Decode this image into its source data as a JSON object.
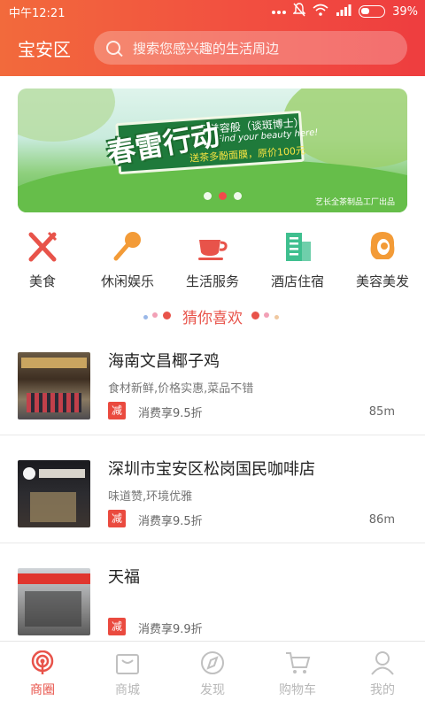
{
  "status_bar": {
    "time": "中午12:21",
    "more_icon": "more-dots-icon",
    "mute_icon": "bell-off-icon",
    "wifi_icon": "wifi-icon",
    "signal_icon": "signal-icon",
    "battery_icon": "battery-icon",
    "battery": "39%"
  },
  "header": {
    "location": "宝安区",
    "search_placeholder": "搜索您感兴趣的生活周边",
    "search_icon": "search-icon"
  },
  "banner": {
    "headline": "春雷行动",
    "line1": "买美容般（谈斑博士）",
    "line2": "Find your beauty here!",
    "line3": "送茶多酚面膜，原价100元",
    "credit": "艺长全茶制品工厂出品",
    "active_dot": 1,
    "dot_count": 3
  },
  "categories": [
    {
      "label": "美食",
      "icon": "fork-knife-icon",
      "color": "#e8534a"
    },
    {
      "label": "休闲娱乐",
      "icon": "microphone-icon",
      "color": "#f39b37"
    },
    {
      "label": "生活服务",
      "icon": "coffee-cup-icon",
      "color": "#e8534a"
    },
    {
      "label": "酒店住宿",
      "icon": "building-icon",
      "color": "#3fbf8f"
    },
    {
      "label": "美容美发",
      "icon": "hair-salon-icon",
      "color": "#f39b37"
    }
  ],
  "section_title": "猜你喜欢",
  "listings": [
    {
      "title": "海南文昌椰子鸡",
      "desc": "食材新鲜,价格实惠,菜品不错",
      "badge": "减",
      "discount": "消费享9.5折",
      "distance": "85m"
    },
    {
      "title": "深圳市宝安区松岗国民咖啡店",
      "desc": "味道赞,环境优雅",
      "badge": "减",
      "discount": "消费享9.5折",
      "distance": "86m"
    },
    {
      "title": "天福",
      "desc": "",
      "badge": "减",
      "discount": "消费享9.9折",
      "distance": ""
    }
  ],
  "bottom_nav": [
    {
      "label": "商圈",
      "icon": "radar-icon",
      "active": true
    },
    {
      "label": "商城",
      "icon": "shopping-bag-icon",
      "active": false
    },
    {
      "label": "发现",
      "icon": "compass-icon",
      "active": false
    },
    {
      "label": "购物车",
      "icon": "cart-icon",
      "active": false
    },
    {
      "label": "我的",
      "icon": "user-icon",
      "active": false
    }
  ],
  "colors": {
    "accent": "#e8534a",
    "header_start": "#f26a3c",
    "header_end": "#ee3d3f",
    "nav_inactive": "#b8b8b8"
  }
}
